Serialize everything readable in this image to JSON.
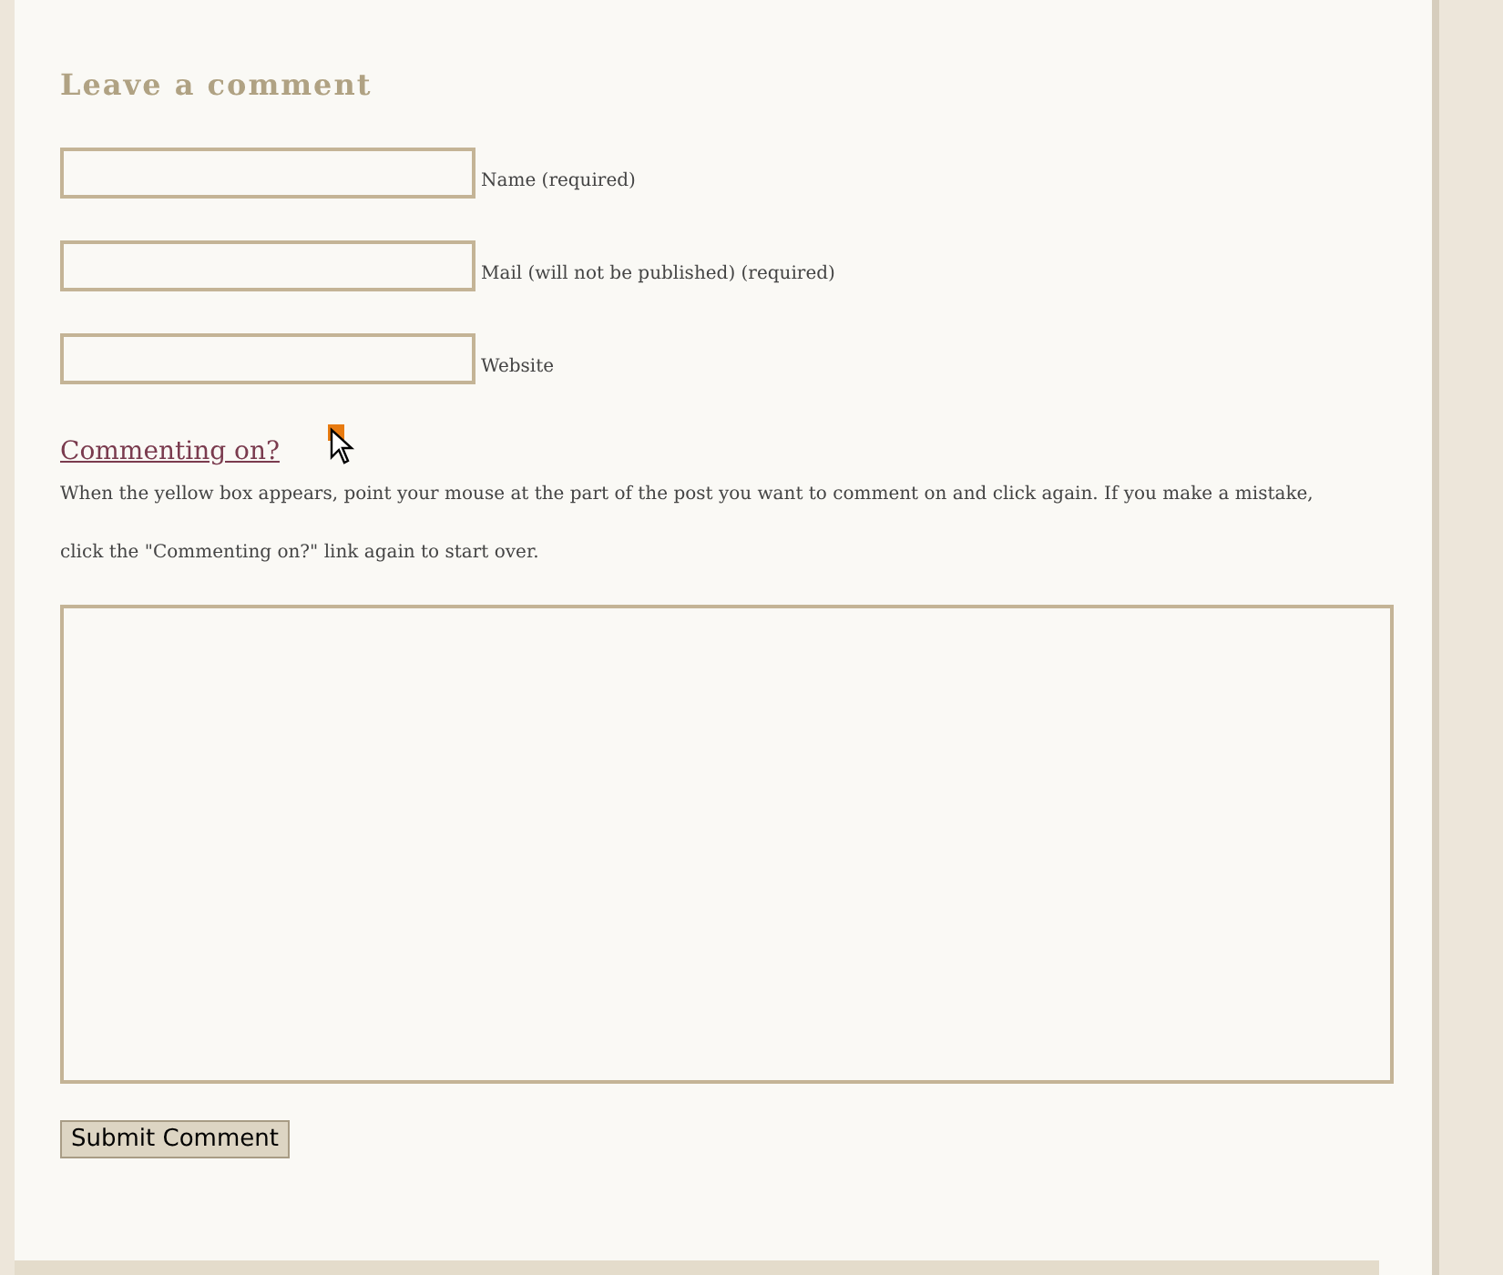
{
  "heading": "Leave a comment",
  "fields": [
    {
      "label": "Name (required)"
    },
    {
      "label": "Mail (will not be published) (required)"
    },
    {
      "label": "Website"
    }
  ],
  "commenting_link": "Commenting on?",
  "instructions": "When the yellow box appears, point your mouse at the part of the post you want to comment on and click again. If you make a mistake, click the \"Commenting on?\" link again to start over.",
  "submit_button": "Submit Comment"
}
